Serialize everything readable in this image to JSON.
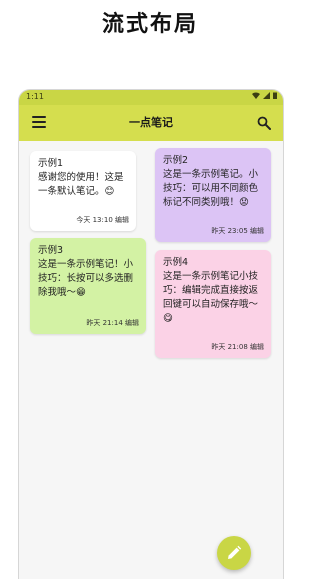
{
  "headline": "流式布局",
  "status": {
    "time": "1:11"
  },
  "appbar": {
    "title": "一点笔记"
  },
  "notes": [
    {
      "title": "示例1",
      "body": "感谢您的使用！这是一条默认笔记。😊",
      "footer": "今天 13:10 编辑",
      "color": "#ffffff"
    },
    {
      "title": "示例2",
      "body": "这是一条示例笔记。小技巧：可以用不同颜色标记不同类别哦！😟",
      "footer": "昨天 23:05 编辑",
      "color": "#dcc4f5"
    },
    {
      "title": "示例3",
      "body": "这是一条示例笔记！小技巧：长按可以多选删除我哦～😁",
      "footer": "昨天 21:14 编辑",
      "color": "#d3f2a4"
    },
    {
      "title": "示例4",
      "body": "这是一条示例笔记小技巧：编辑完成直接按返回键可以自动保存哦～😋",
      "footer": "昨天 21:08 编辑",
      "color": "#fbd2e6"
    }
  ],
  "colors": {
    "appbar": "#d5de4e",
    "statusbar": "#c9d645",
    "fab": "#c9d645"
  },
  "icons": {
    "menu": "hamburger-menu-icon",
    "search": "search-icon",
    "fab": "pencil-icon"
  }
}
